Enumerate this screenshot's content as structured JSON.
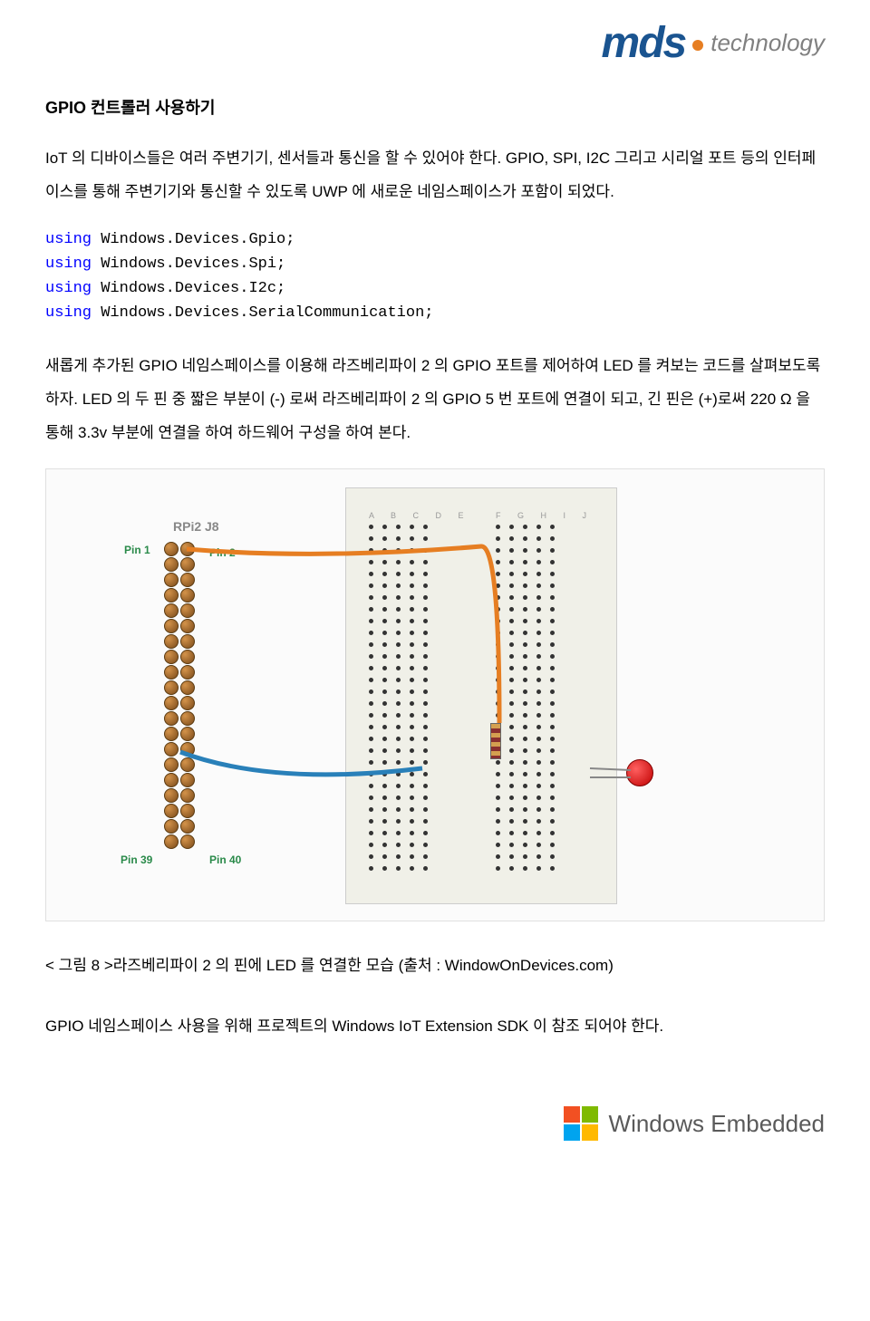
{
  "header": {
    "logo_brand": "mds",
    "logo_suffix": "technology"
  },
  "content": {
    "section_title": "GPIO 컨트롤러 사용하기",
    "para1": "IoT 의 디바이스들은 여러 주변기기, 센서들과 통신을 할 수 있어야 한다. GPIO, SPI, I2C 그리고 시리얼 포트 등의 인터페이스를 통해 주변기기와 통신할 수 있도록 UWP 에 새로운 네임스페이스가 포함이 되었다.",
    "code_lines": [
      {
        "keyword": "using",
        "text": " Windows.Devices.Gpio;"
      },
      {
        "keyword": "using",
        "text": " Windows.Devices.Spi;"
      },
      {
        "keyword": "using",
        "text": " Windows.Devices.I2c;"
      },
      {
        "keyword": "using",
        "text": " Windows.Devices.SerialCommunication;"
      }
    ],
    "para2": "새롭게 추가된 GPIO 네임스페이스를 이용해 라즈베리파이 2 의 GPIO 포트를 제어하여 LED 를 켜보는 코드를 살펴보도록 하자. LED 의 두 핀 중 짧은 부분이 (-) 로써 라즈베리파이 2 의 GPIO 5 번 포트에 연결이 되고, 긴 핀은 (+)로써 220 Ω 을 통해 3.3v 부분에 연결을 하여 하드웨어 구성을 하여 본다.",
    "diagram": {
      "rpi_label": "RPi2 J8",
      "pin1": "Pin 1",
      "pin2": "Pin 2",
      "pin39": "Pin 39",
      "pin40": "Pin 40",
      "col_labels_left": "A B C D E",
      "col_labels_right": "F G H I J"
    },
    "caption": "< 그림 8 >라즈베리파이 2 의 핀에 LED 를 연결한 모습 (출처 : WindowOnDevices.com)",
    "para3": "GPIO 네임스페이스 사용을 위해 프로젝트의 Windows IoT Extension SDK 이 참조 되어야 한다."
  },
  "footer": {
    "win_embedded": "Windows Embedded"
  }
}
